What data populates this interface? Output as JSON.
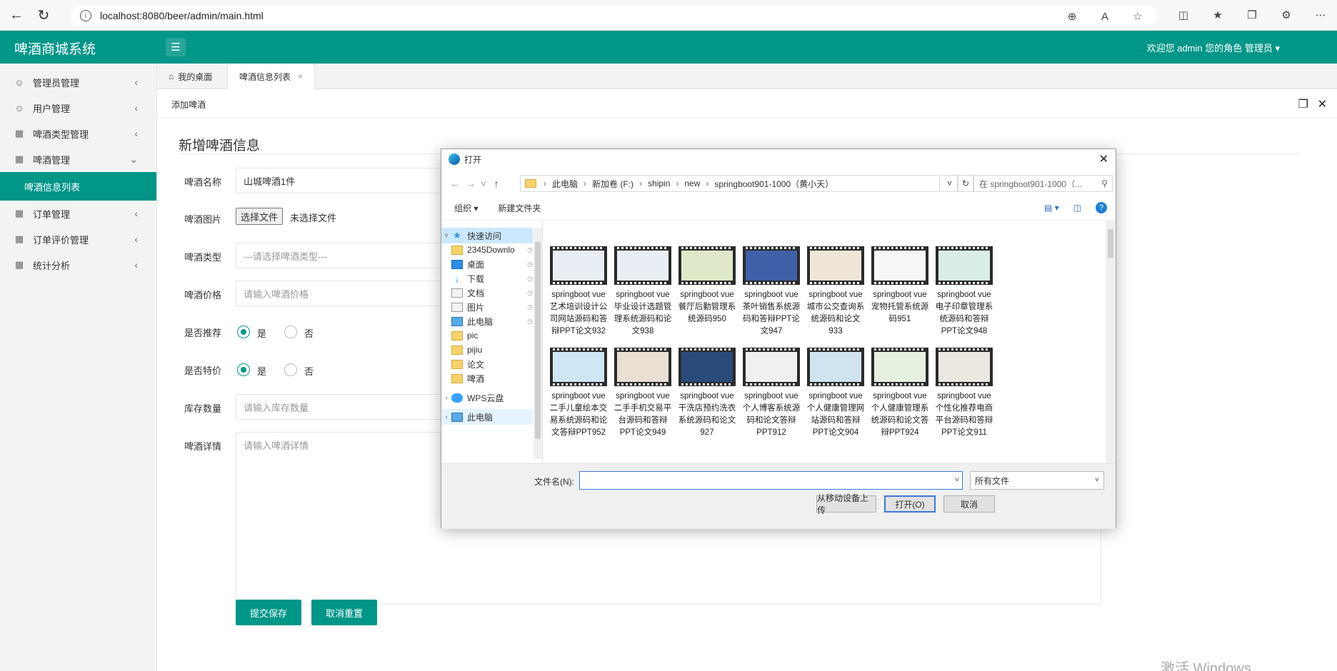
{
  "browser": {
    "url": "localhost:8080/beer/admin/main.html"
  },
  "header": {
    "app_title": "啤酒商城系统",
    "welcome": "欢迎您 admin 您的角色 管理员"
  },
  "sidebar": {
    "items": [
      {
        "label": "管理员管理"
      },
      {
        "label": "用户管理"
      },
      {
        "label": "啤酒类型管理"
      },
      {
        "label": "啤酒管理"
      }
    ],
    "active_sub": "啤酒信息列表",
    "items_after": [
      {
        "label": "订单管理"
      },
      {
        "label": "订单评价管理"
      },
      {
        "label": "统计分析"
      }
    ]
  },
  "tabs": [
    {
      "label": "我的桌面"
    },
    {
      "label": "啤酒信息列表"
    }
  ],
  "subbar": {
    "title": "添加啤酒"
  },
  "form": {
    "title": "新增啤酒信息",
    "name_label": "啤酒名称",
    "name_value": "山城啤酒1件",
    "image_label": "啤酒图片",
    "file_button": "选择文件",
    "no_file": "未选择文件",
    "type_label": "啤酒类型",
    "type_placeholder": "---请选择啤酒类型---",
    "price_label": "啤酒价格",
    "price_placeholder": "请输入啤酒价格",
    "recommend_label": "是否推荐",
    "special_label": "是否特价",
    "yes": "是",
    "no": "否",
    "stock_label": "库存数量",
    "stock_placeholder": "请输入库存数量",
    "detail_label": "啤酒详情",
    "detail_placeholder": "请输入啤酒详情",
    "submit": "提交保存",
    "reset": "取消重置"
  },
  "watermark": "激活 Windows",
  "dialog": {
    "title": "打开",
    "breadcrumb": [
      "此电脑",
      "新加卷 (F:)",
      "shipin",
      "new",
      "springboot901-1000（黄小天）"
    ],
    "search_placeholder": "在 springboot901-1000（...",
    "organize": "组织 ▾",
    "new_folder": "新建文件夹",
    "nav": [
      {
        "label": "快速访问",
        "icon": "star-icon"
      },
      {
        "label": "2345Downlo",
        "icon": "folder-icon"
      },
      {
        "label": "桌面",
        "icon": "desktop-icon"
      },
      {
        "label": "下载",
        "icon": "download-icon"
      },
      {
        "label": "文档",
        "icon": "document-icon"
      },
      {
        "label": "图片",
        "icon": "picture-icon"
      },
      {
        "label": "此电脑",
        "icon": "computer-icon"
      },
      {
        "label": "pic",
        "icon": "folder-icon"
      },
      {
        "label": "pijiu",
        "icon": "folder-icon"
      },
      {
        "label": "论文",
        "icon": "folder-icon"
      },
      {
        "label": "啤酒",
        "icon": "folder-icon"
      },
      {
        "label": "WPS云盘",
        "icon": "cloud-icon"
      },
      {
        "label": "此电脑",
        "icon": "computer-icon"
      }
    ],
    "files": [
      "springboot vue艺术培训设计公司网站源码和答辩PPT论文932",
      "springboot vue毕业设计选题管理系统源码和论文938",
      "springboot vue餐厅后勤管理系统源码950",
      "springboot vue茶叶销售系统源码和答辩PPT论文947",
      "springboot vue城市公交查询系统源码和论文933",
      "springboot vue宠物托管系统源码951",
      "springboot vue电子印章管理系统源码和答辩PPT论文948",
      "springboot vue二手儿童绘本交易系统源码和论文答辩PPT952",
      "springboot vue二手手机交易平台源码和答辩PPT论文949",
      "springboot vue干洗店预约洗衣系统源码和论文927",
      "springboot vue个人博客系统源码和论文答辩PPT912",
      "springboot vue个人健康管理网站源码和答辩PPT论文904",
      "springboot vue个人健康管理系统源码和论文答辩PPT924",
      "springboot vue个性化推荐电商平台源码和答辩PPT论文911"
    ],
    "filename_label": "文件名(N):",
    "filename_value": "",
    "filter": "所有文件",
    "upload_mobile": "从移动设备上传",
    "open": "打开(O)",
    "cancel": "取消"
  }
}
